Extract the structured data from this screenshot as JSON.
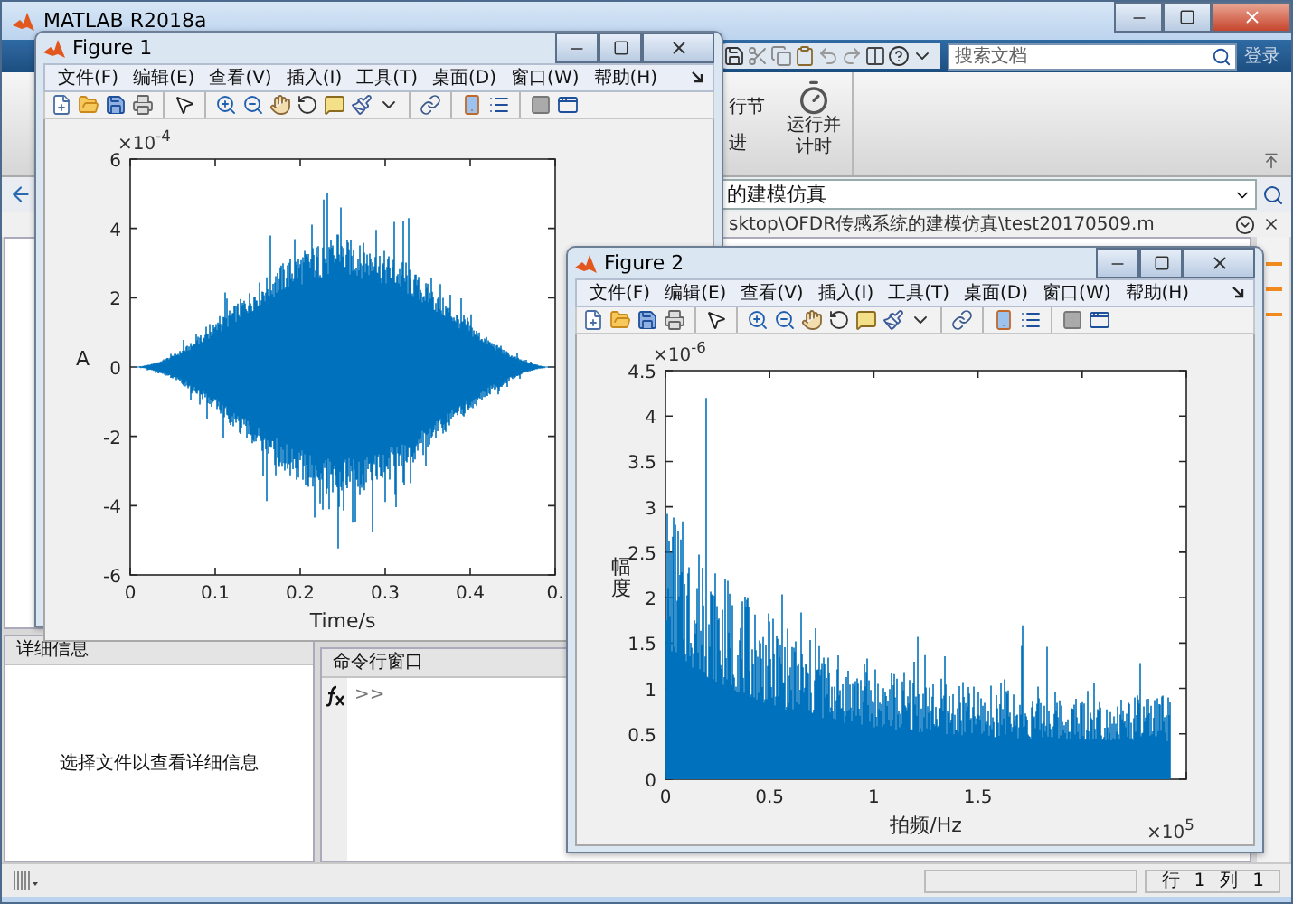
{
  "main_window": {
    "title": "MATLAB R2018a",
    "search": {
      "placeholder": "搜索文档"
    },
    "sign_in": "登录",
    "ribbon": {
      "section_labels": [
        "行节",
        "进"
      ],
      "run_and_time": [
        "运行并",
        "计时"
      ]
    },
    "address": "的建模仿真",
    "path": "sktop\\OFDR传感系统的建模仿真\\test20170509.m",
    "details_panel": {
      "title": "详细信息",
      "message": "选择文件以查看详细信息"
    },
    "command_window": {
      "title": "命令行窗口",
      "prompt": ">>"
    },
    "status_bar": {
      "row_label": "行",
      "row": "1",
      "column_label": "列",
      "column": "1"
    }
  },
  "figures": [
    {
      "title": "Figure 1",
      "menu": [
        "文件(F)",
        "编辑(E)",
        "查看(V)",
        "插入(I)",
        "工具(T)",
        "桌面(D)",
        "窗口(W)",
        "帮助(H)"
      ],
      "axes": {
        "kind": "waveform",
        "y_exponent": "×10$^{-4}$",
        "y_ticks": [
          "6",
          "4",
          "2",
          "0",
          "-2",
          "-4",
          "-6"
        ],
        "x_ticks": [
          "0",
          "0.1",
          "0.2",
          "0.3",
          "0.4",
          "0."
        ],
        "xlabel": "Time/s",
        "ylabel": "A"
      }
    },
    {
      "title": "Figure 2",
      "menu": [
        "文件(F)",
        "编辑(E)",
        "查看(V)",
        "插入(I)",
        "工具(T)",
        "桌面(D)",
        "窗口(W)",
        "帮助(H)"
      ],
      "axes": {
        "kind": "spectrum",
        "y_exponent": "×10$^{-6}$",
        "y_ticks": [
          "4.5",
          "4",
          "3.5",
          "3",
          "2.5",
          "2",
          "1.5",
          "1",
          "0.5",
          "0"
        ],
        "x_ticks": [
          "0",
          "0.5",
          "1",
          "1.5"
        ],
        "x_exponent": "×10$^{5}$",
        "xlabel": "拍频/Hz",
        "ylabel": "幅度"
      }
    }
  ]
}
